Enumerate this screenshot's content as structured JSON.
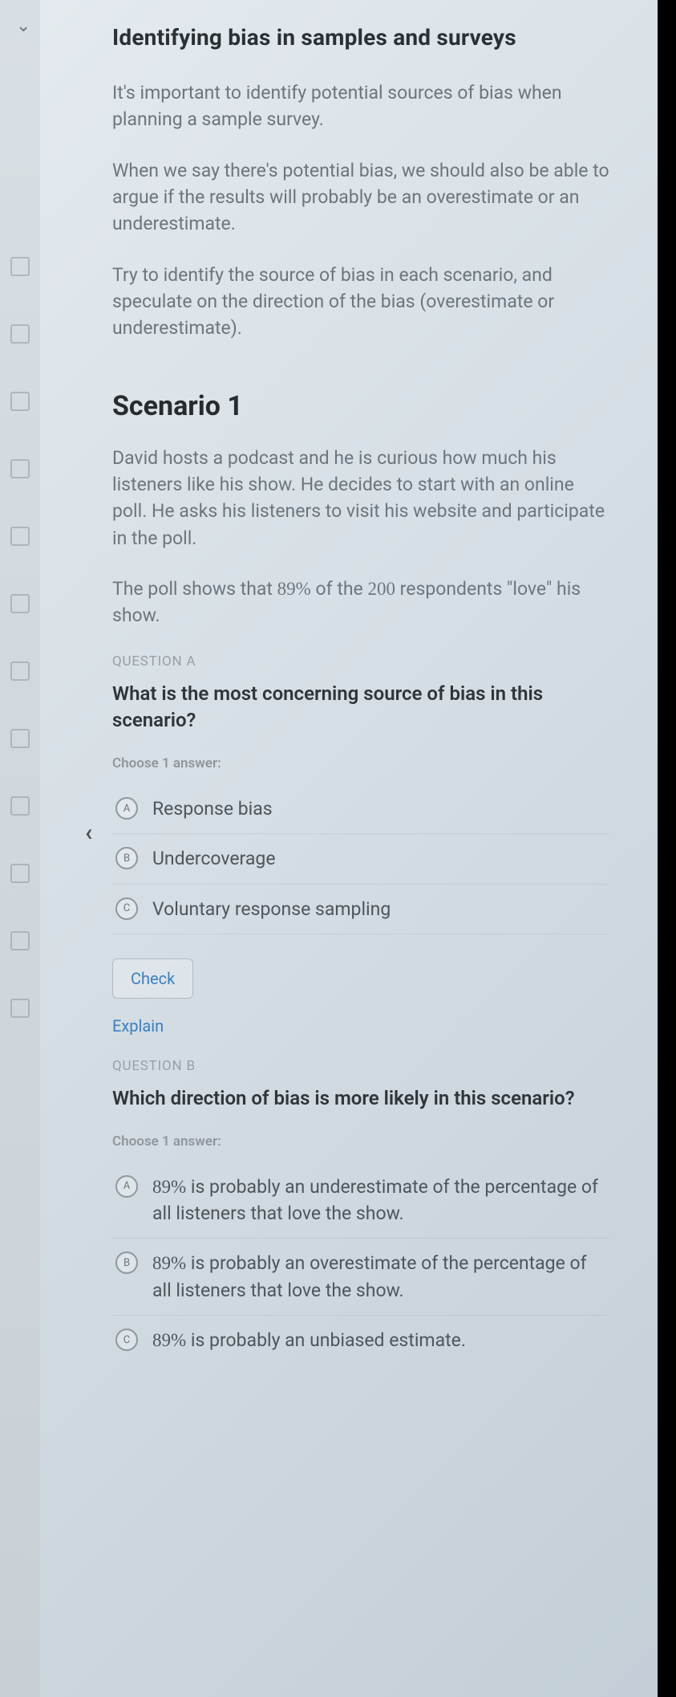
{
  "title": "Identifying bias in samples and surveys",
  "intro": {
    "p1": "It's important to identify potential sources of bias when planning a sample survey.",
    "p2": "When we say there's potential bias, we should also be able to argue if the results will probably be an overestimate or an underestimate.",
    "p3": "Try to identify the source of bias in each scenario, and speculate on the direction of the bias (overestimate or underestimate)."
  },
  "scenario": {
    "heading": "Scenario 1",
    "p1": "David hosts a podcast and he is curious how much his listeners like his show. He decides to start with an online poll. He asks his listeners to visit his website and participate in the poll.",
    "p2": "The poll shows that 89% of the 200 respondents \"love\" his show."
  },
  "questionA": {
    "label": "QUESTION A",
    "prompt": "What is the most concerning source of bias in this scenario?",
    "choose": "Choose 1 answer:",
    "options": {
      "a": "Response bias",
      "b": "Undercoverage",
      "c": "Voluntary response sampling"
    },
    "check": "Check",
    "explain": "Explain"
  },
  "questionB": {
    "label": "QUESTION B",
    "prompt": "Which direction of bias is more likely in this scenario?",
    "choose": "Choose 1 answer:",
    "options": {
      "a": "89% is probably an underestimate of the percentage of all listeners that love the show.",
      "b": "89% is probably an overestimate of the percentage of all listeners that love the show.",
      "c": "89% is probably an unbiased estimate."
    }
  }
}
